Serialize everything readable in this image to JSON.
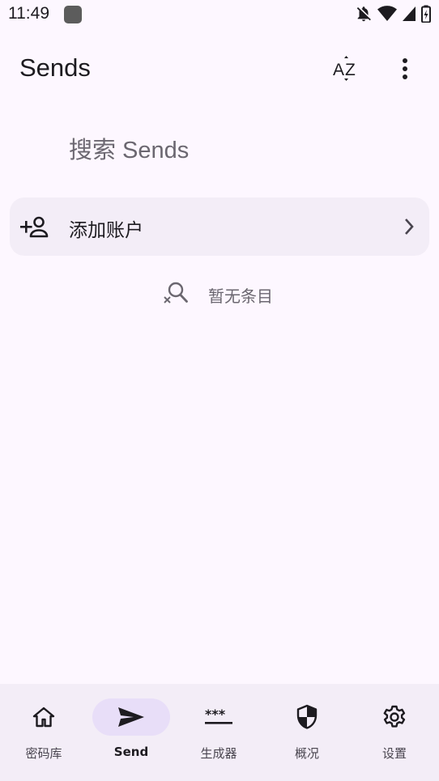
{
  "status_bar": {
    "time": "11:49",
    "icons": [
      "app-notification-icon",
      "notifications-off-icon",
      "wifi-icon",
      "cell-signal-icon",
      "battery-icon"
    ]
  },
  "app_bar": {
    "title": "Sends",
    "actions": [
      "sort-az-icon",
      "more-vert-icon"
    ]
  },
  "search": {
    "placeholder": "搜索 Sends"
  },
  "add_account": {
    "label": "添加账户",
    "icon": "person-add-icon"
  },
  "empty_state": {
    "label": "暂无条目",
    "icon": "search-off-icon"
  },
  "bottom_nav": {
    "items": [
      {
        "label": "密码库",
        "icon": "home-icon",
        "active": false
      },
      {
        "label": "Send",
        "icon": "send-icon",
        "active": true
      },
      {
        "label": "生成器",
        "icon": "password-generator-icon",
        "active": false
      },
      {
        "label": "概况",
        "icon": "shield-icon",
        "active": false
      },
      {
        "label": "设置",
        "icon": "gear-icon",
        "active": false
      }
    ]
  },
  "colors": {
    "background": "#fdf7ff",
    "surface_container": "#f3edf7",
    "active_indicator": "#e8def8",
    "text_primary": "#1d1b20",
    "text_secondary": "#6b6770"
  }
}
